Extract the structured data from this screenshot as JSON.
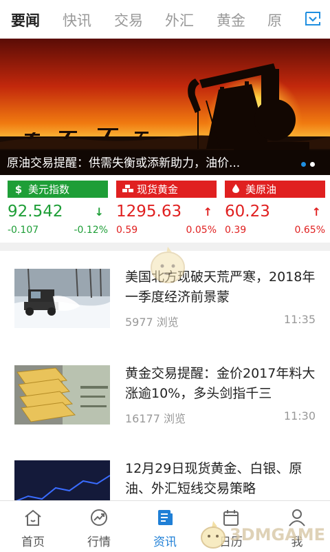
{
  "tabs": [
    {
      "label": "要闻",
      "active": true
    },
    {
      "label": "快讯",
      "active": false
    },
    {
      "label": "交易",
      "active": false
    },
    {
      "label": "外汇",
      "active": false
    },
    {
      "label": "黄金",
      "active": false
    },
    {
      "label": "原",
      "active": false
    }
  ],
  "tab_more_icon": "expand-down-icon",
  "banner": {
    "title": "原油交易提醒：供需失衡或添新助力，油价...",
    "slide_count": 2,
    "active_slide": 1
  },
  "quotes": [
    {
      "name": "美元指数",
      "icon": "dollar-icon",
      "price": "92.542",
      "direction": "down",
      "change": "-0.107",
      "percent": "-0.12%",
      "color": "#1e9e37"
    },
    {
      "name": "现货黄金",
      "icon": "gold-bars-icon",
      "price": "1295.63",
      "direction": "up",
      "change": "0.59",
      "percent": "0.05%",
      "color": "#e02020"
    },
    {
      "name": "美原油",
      "icon": "oil-drop-icon",
      "price": "60.23",
      "direction": "up",
      "change": "0.39",
      "percent": "0.65%",
      "color": "#e02020"
    }
  ],
  "news": [
    {
      "title": "美国北方现破天荒严寒，2018年一季度经济前景蒙",
      "views": "5977 浏览",
      "time": "11:35",
      "thumb": "snow-plow-image"
    },
    {
      "title": "黄金交易提醒：金价2017年料大涨逾10%，多头剑指千三",
      "views": "16177 浏览",
      "time": "11:30",
      "thumb": "gold-bars-image"
    },
    {
      "title": "12月29日现货黄金、白银、原油、外汇短线交易策略",
      "views": "",
      "time": "",
      "thumb": "coins-chart-image"
    }
  ],
  "bottom_nav": [
    {
      "label": "首页",
      "icon": "home-icon",
      "active": false
    },
    {
      "label": "行情",
      "icon": "trend-icon",
      "active": false
    },
    {
      "label": "资讯",
      "icon": "news-icon",
      "active": true
    },
    {
      "label": "日历",
      "icon": "calendar-icon",
      "active": false
    },
    {
      "label": "我",
      "icon": "user-icon",
      "active": false
    }
  ],
  "watermark": {
    "text": "3DMGAME"
  }
}
